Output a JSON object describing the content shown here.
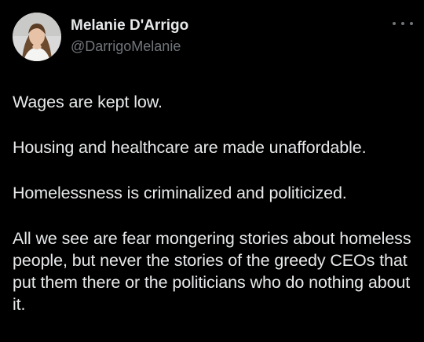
{
  "post": {
    "author": {
      "display_name": "Melanie D'Arrigo",
      "handle": "@DarrigoMelanie",
      "avatar_icon": "profile-photo"
    },
    "more_icon": "ellipsis-icon",
    "paragraphs": [
      "Wages are kept low.",
      "Housing and healthcare are made unaffordable.",
      "Homelessness is criminalized and politicized.",
      "All we see are fear mongering stories about homeless people, but never the stories of the greedy CEOs that put them there or the politicians who do nothing about it."
    ]
  },
  "colors": {
    "background": "#000000",
    "primary_text": "#e7e9ea",
    "secondary_text": "#71767b"
  }
}
